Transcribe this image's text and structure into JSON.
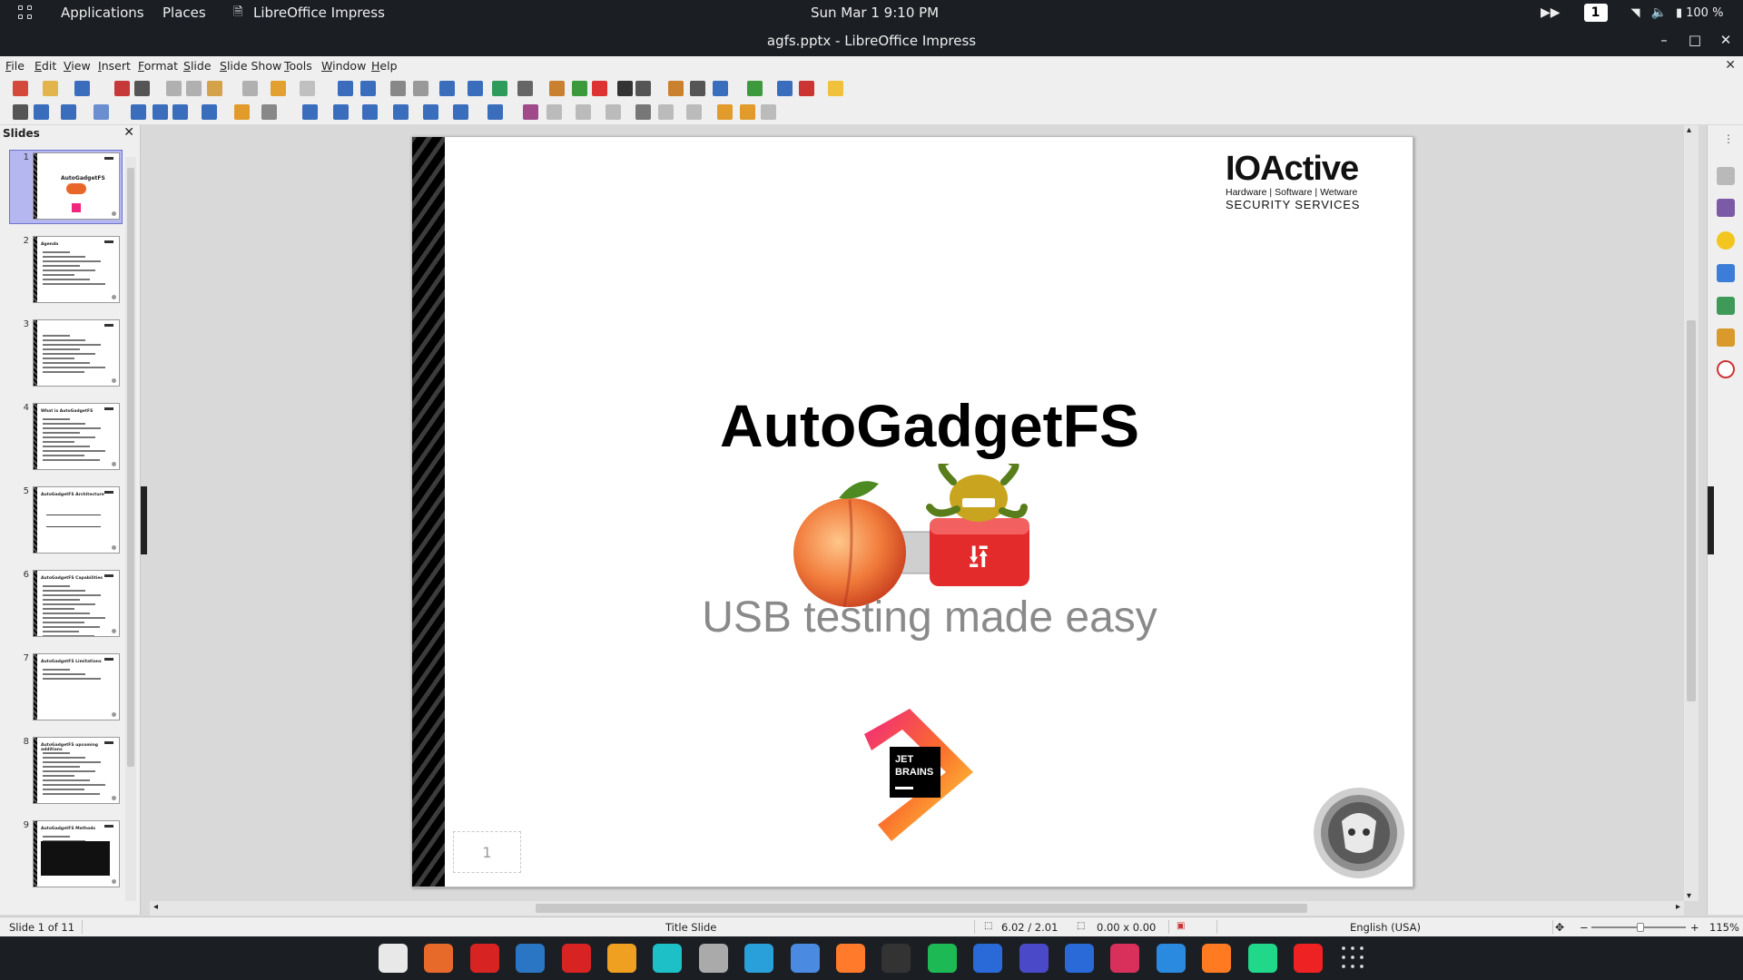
{
  "topbar": {
    "applications": "Applications",
    "places": "Places",
    "active_app": "LibreOffice Impress",
    "clock": "Sun Mar 1   9:10 PM",
    "workspace": "1",
    "battery": "100 %"
  },
  "window": {
    "title": "agfs.pptx - LibreOffice Impress",
    "minimize": "–",
    "maximize": "□",
    "close": "✕"
  },
  "menu": [
    "File",
    "Edit",
    "View",
    "Insert",
    "Format",
    "Slide",
    "Slide Show",
    "Tools",
    "Window",
    "Help"
  ],
  "slides_panel": {
    "header": "Slides",
    "close": "✕",
    "thumbnails": [
      {
        "num": "1",
        "title": "AutoGadgetFS"
      },
      {
        "num": "2",
        "title": "Agenda"
      },
      {
        "num": "3",
        "title": ""
      },
      {
        "num": "4",
        "title": "What is AutoGadgetFS"
      },
      {
        "num": "5",
        "title": "AutoGadgetFS Architecture"
      },
      {
        "num": "6",
        "title": "AutoGadgetFS Capabilities"
      },
      {
        "num": "7",
        "title": "AutoGadgetFS Limitations"
      },
      {
        "num": "8",
        "title": "AutoGadgetFS upcoming additions"
      },
      {
        "num": "9",
        "title": "AutoGadgetFS Methods"
      }
    ]
  },
  "slide": {
    "title": "AutoGadgetFS",
    "subtitle": "USB testing made easy",
    "number": "1",
    "brand_name": "IOActive",
    "brand_tagline": "Hardware | Software | Wetware",
    "brand_services": "SECURITY SERVICES",
    "jetbrains_text_1": "JET",
    "jetbrains_text_2": "BRAINS"
  },
  "status": {
    "slide_position": "Slide 1 of 11",
    "layout": "Title Slide",
    "cursor_pos": "6.02 / 2.01",
    "size": "0.00 x 0.00",
    "language": "English (USA)",
    "zoom": "115%",
    "zoom_fraction": 0.52
  },
  "colors": {
    "panel_bg": "#efefef",
    "gnome_bar": "#1b1f24",
    "selection": "#b4b7f0",
    "subtitle": "#8a8a8a"
  },
  "dock_icons": [
    "files-icon",
    "firefox-icon",
    "red-app-icon",
    "kde-icon",
    "code-icon",
    "mail-icon",
    "browser-icon",
    "database-icon",
    "telegram-icon",
    "chrome-icon",
    "sublime-icon",
    "obs-icon",
    "spotify-icon",
    "whale-icon",
    "virtualbox-icon",
    "teamviewer-icon",
    "intellij-icon",
    "download-icon",
    "impress-icon",
    "pycharm-icon",
    "flag-icon",
    "app-grid-icon"
  ]
}
